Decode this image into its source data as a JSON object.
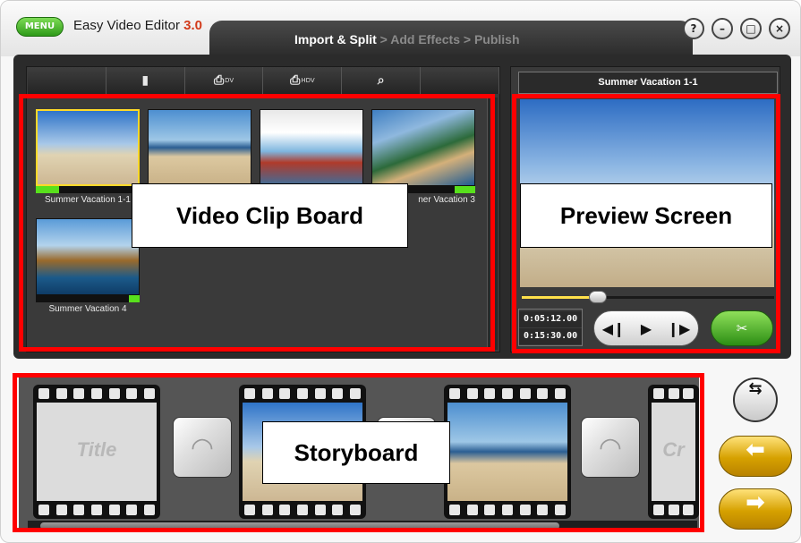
{
  "app": {
    "menu_label": "MENU",
    "title": "Easy Video Editor",
    "version": "3.0"
  },
  "steps": {
    "current": "Import & Split",
    "next": " > Add Effects > Publish"
  },
  "window_buttons": [
    "?",
    "–",
    "□",
    "×"
  ],
  "import_toolbar": [
    {
      "icon": "file-icon",
      "glyph": "▮",
      "small": ""
    },
    {
      "icon": "dv-camera-icon",
      "glyph": "⎙",
      "small": "DV"
    },
    {
      "icon": "hdv-camera-icon",
      "glyph": "⎙",
      "small": "HDV"
    },
    {
      "icon": "tv-capture-icon",
      "glyph": "⌕",
      "small": ""
    }
  ],
  "clips": [
    {
      "label": "Summer Vacation 1-1",
      "progress": 0.22,
      "selected": true
    },
    {
      "label": "",
      "progress": 0,
      "selected": false
    },
    {
      "label": "",
      "progress": 0,
      "selected": false
    },
    {
      "label": "ner Vacation 3",
      "progress": 0.2,
      "selected": false
    },
    {
      "label": "Summer Vacation 4",
      "progress": 0.1,
      "selected": false
    }
  ],
  "preview": {
    "title": "Summer Vacation 1-1",
    "position": 0.3,
    "time_current": "0:05:12.00",
    "time_total": "0:15:30.00",
    "split_label": "✂"
  },
  "storyboard": {
    "title_frame": "Title",
    "end_frame": "Cr"
  },
  "callouts": {
    "clip_board": "Video Clip Board",
    "preview": "Preview Screen",
    "storyboard": "Storyboard"
  },
  "nav": {
    "mode_glyph": "⇆",
    "back_glyph": "⬅",
    "next_glyph": "➡"
  }
}
